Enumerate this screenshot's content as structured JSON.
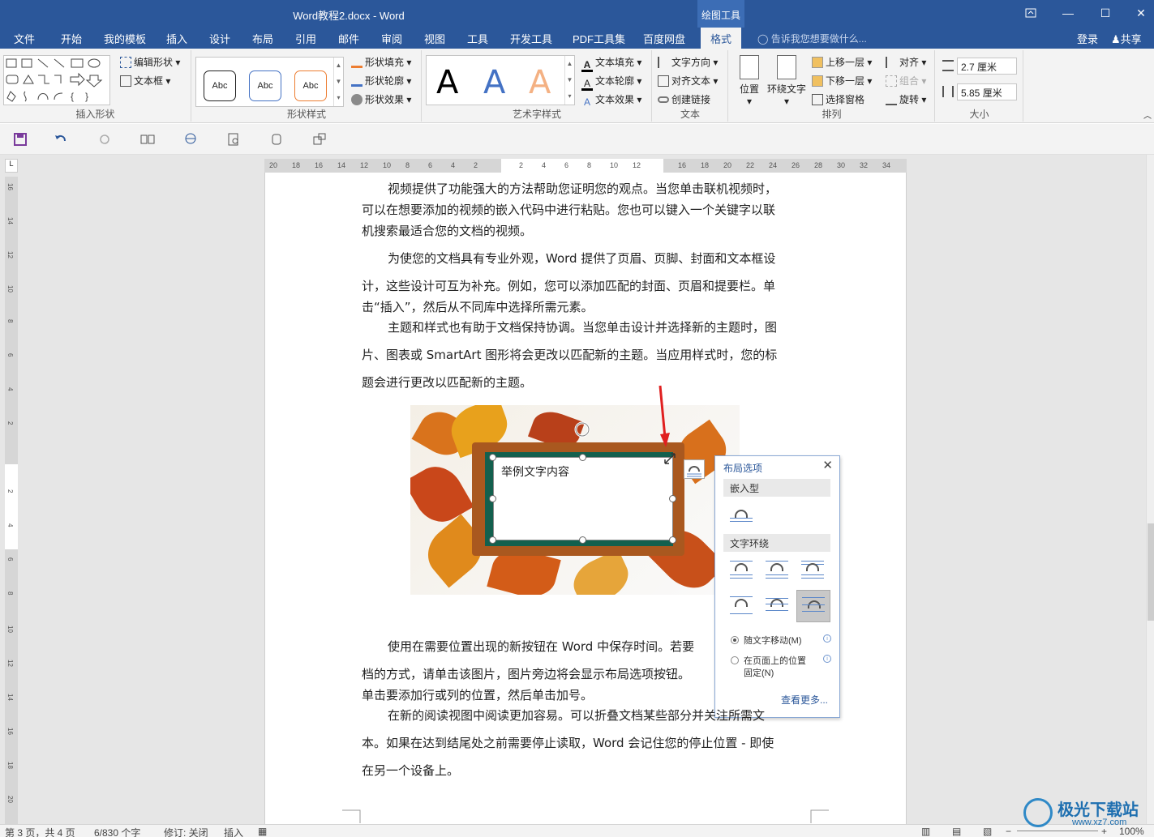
{
  "window": {
    "title": "Word教程2.docx - Word",
    "context_tab": "绘图工具",
    "restore_icon": "ribbon-display-icon",
    "min": "—",
    "max": "☐",
    "close": "✕"
  },
  "tabs": [
    "文件",
    "开始",
    "我的模板",
    "插入",
    "设计",
    "布局",
    "引用",
    "邮件",
    "审阅",
    "视图",
    "工具",
    "开发工具",
    "PDF工具集",
    "百度网盘",
    "格式"
  ],
  "active_tab": "格式",
  "tell_me": "告诉我您想要做什么...",
  "login": "登录",
  "share": "共享",
  "ribbon": {
    "insert_shapes": {
      "label": "插入形状",
      "edit_shape": "编辑形状",
      "text_box": "文本框"
    },
    "shape_styles": {
      "label": "形状样式",
      "sample": "Abc",
      "fill": "形状填充",
      "outline": "形状轮廓",
      "effects": "形状效果"
    },
    "wordart": {
      "label": "艺术字样式",
      "sample": "A",
      "text_fill": "文本填充",
      "text_outline": "文本轮廓",
      "text_effects": "文本效果"
    },
    "text": {
      "label": "文本",
      "direction": "文字方向",
      "align": "对齐文本",
      "link": "创建链接"
    },
    "arrange": {
      "label": "排列",
      "position": "位置",
      "wrap": "环绕文字",
      "forward": "上移一层",
      "backward": "下移一层",
      "pane": "选择窗格",
      "align": "对齐",
      "group": "组合",
      "rotate": "旋转"
    },
    "size": {
      "label": "大小",
      "height": "2.7 厘米",
      "width": "5.85 厘米"
    }
  },
  "hruler_ticks": [
    "20",
    "18",
    "16",
    "14",
    "12",
    "10",
    "8",
    "6",
    "4",
    "2",
    "",
    "2",
    "4",
    "6",
    "8",
    "10",
    "12",
    "",
    "16",
    "18",
    "20",
    "22",
    "24",
    "26",
    "28",
    "30",
    "32",
    "34"
  ],
  "vruler_ticks": [
    "16",
    "14",
    "12",
    "10",
    "8",
    "6",
    "4",
    "2",
    "",
    "2",
    "4",
    "6",
    "8",
    "10",
    "12",
    "14",
    "16",
    "18",
    "20"
  ],
  "document": {
    "p1": [
      "视频提供了功能强大的方法帮助您证明您的观点。当您单击联机视频时，",
      "可以在想要添加的视频的嵌入代码中进行粘贴。您也可以键入一个关键字以联",
      "机搜索最适合您的文档的视频。"
    ],
    "p2": [
      "为使您的文档具有专业外观，Word 提供了页眉、页脚、封面和文本框设",
      "计，这些设计可互为补充。例如，您可以添加匹配的封面、页眉和提要栏。单",
      "击“插入”，然后从不同库中选择所需元素。"
    ],
    "p3": [
      "主题和样式也有助于文档保持协调。当您单击设计并选择新的主题时，图",
      "片、图表或 SmartArt 图形将会更改以匹配新的主题。当应用样式时，您的标",
      "题会进行更改以匹配新的主题。"
    ],
    "textbox": "举例文字内容",
    "p4": [
      "使用在需要位置出现的新按钮在 Word 中保存时间。若要",
      "档的方式，请单击该图片，图片旁边将会显示布局选项按钮。",
      "单击要添加行或列的位置，然后单击加号。"
    ],
    "p5": [
      "在新的阅读视图中阅读更加容易。可以折叠文档某些部分并关注所需文",
      "本。如果在达到结尾处之前需要停止读取，Word 会记住您的停止位置 - 即使",
      "在另一个设备上。"
    ]
  },
  "layout_panel": {
    "title": "布局选项",
    "close": "✕",
    "inline": "嵌入型",
    "wrap": "文字环绕",
    "move_with_text": "随文字移动(M)",
    "fix_on_page": "在页面上的位置",
    "fix_on_page_2": "固定(N)",
    "see_more": "查看更多..."
  },
  "status": {
    "page": "第 3 页，共 4 页",
    "words": "6/830 个字",
    "track": "修订: 关闭",
    "insert": "插入",
    "zoom": "100%"
  },
  "watermark": {
    "name": "极光下载站",
    "url": "www.xz7.com"
  },
  "colors": {
    "brand": "#2b579a",
    "arrow": "#e02020"
  }
}
